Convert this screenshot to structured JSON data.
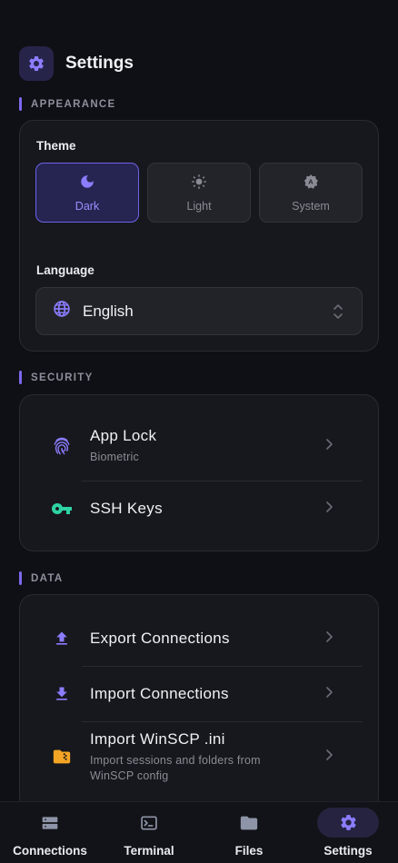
{
  "header": {
    "title": "Settings",
    "icon": "gear-icon"
  },
  "sections": {
    "appearance": "APPEARANCE",
    "security": "SECURITY",
    "data": "DATA"
  },
  "appearance": {
    "theme_label": "Theme",
    "themes": [
      {
        "label": "Dark",
        "icon": "moon-icon",
        "selected": true
      },
      {
        "label": "Light",
        "icon": "sun-icon",
        "selected": false
      },
      {
        "label": "System",
        "icon": "auto-theme-icon",
        "selected": false
      }
    ],
    "language_label": "Language",
    "language_value": "English"
  },
  "security": {
    "items": [
      {
        "title": "App Lock",
        "subtitle": "Biometric",
        "icon": "fingerprint-icon"
      },
      {
        "title": "SSH Keys",
        "icon": "key-icon"
      }
    ]
  },
  "data": {
    "items": [
      {
        "title": "Export Connections",
        "icon": "upload-icon"
      },
      {
        "title": "Import Connections",
        "icon": "download-icon"
      },
      {
        "title": "Import WinSCP .ini",
        "subtitle": "Import sessions and folders from WinSCP config",
        "icon": "zip-folder-icon"
      }
    ]
  },
  "nav": {
    "items": [
      {
        "label": "Connections",
        "icon": "server-icon",
        "active": false
      },
      {
        "label": "Terminal",
        "icon": "terminal-icon",
        "active": false
      },
      {
        "label": "Files",
        "icon": "folder-icon",
        "active": false
      },
      {
        "label": "Settings",
        "icon": "gear-icon",
        "active": true
      }
    ]
  },
  "colors": {
    "background": "#0f1015",
    "accent": "#7b68ee",
    "key_green": "#2fd3a4",
    "folder_orange": "#f5a524"
  }
}
